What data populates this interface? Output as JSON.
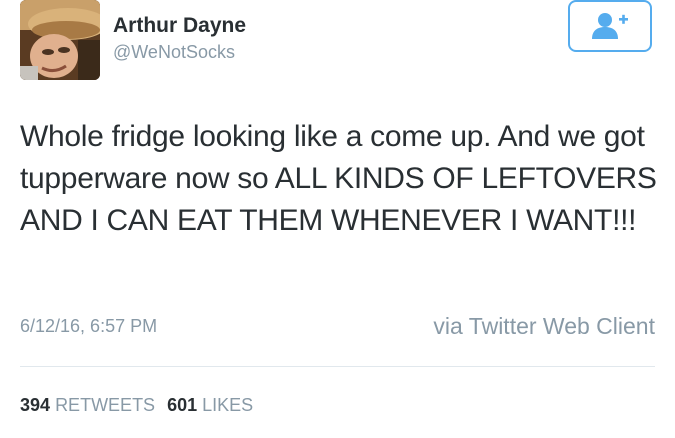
{
  "author": {
    "name": "Arthur Dayne",
    "handle": "@WeNotSocks"
  },
  "tweet": {
    "text": "Whole fridge looking like a come up. And we got tupperware now so ALL KINDS OF LEFTOVERS AND I CAN EAT THEM WHENEVER I WANT!!!",
    "timestamp": "6/12/16, 6:57 PM",
    "source": "via Twitter Web Client"
  },
  "stats": {
    "retweets_count": "394",
    "retweets_label": "RETWEETS",
    "likes_count": "601",
    "likes_label": "LIKES"
  },
  "icons": {
    "follow": "add-user-icon",
    "avatar": "profile-photo"
  },
  "colors": {
    "accent": "#55acee",
    "text": "#292f33",
    "muted": "#8899a6",
    "divider": "#e1e8ed"
  }
}
